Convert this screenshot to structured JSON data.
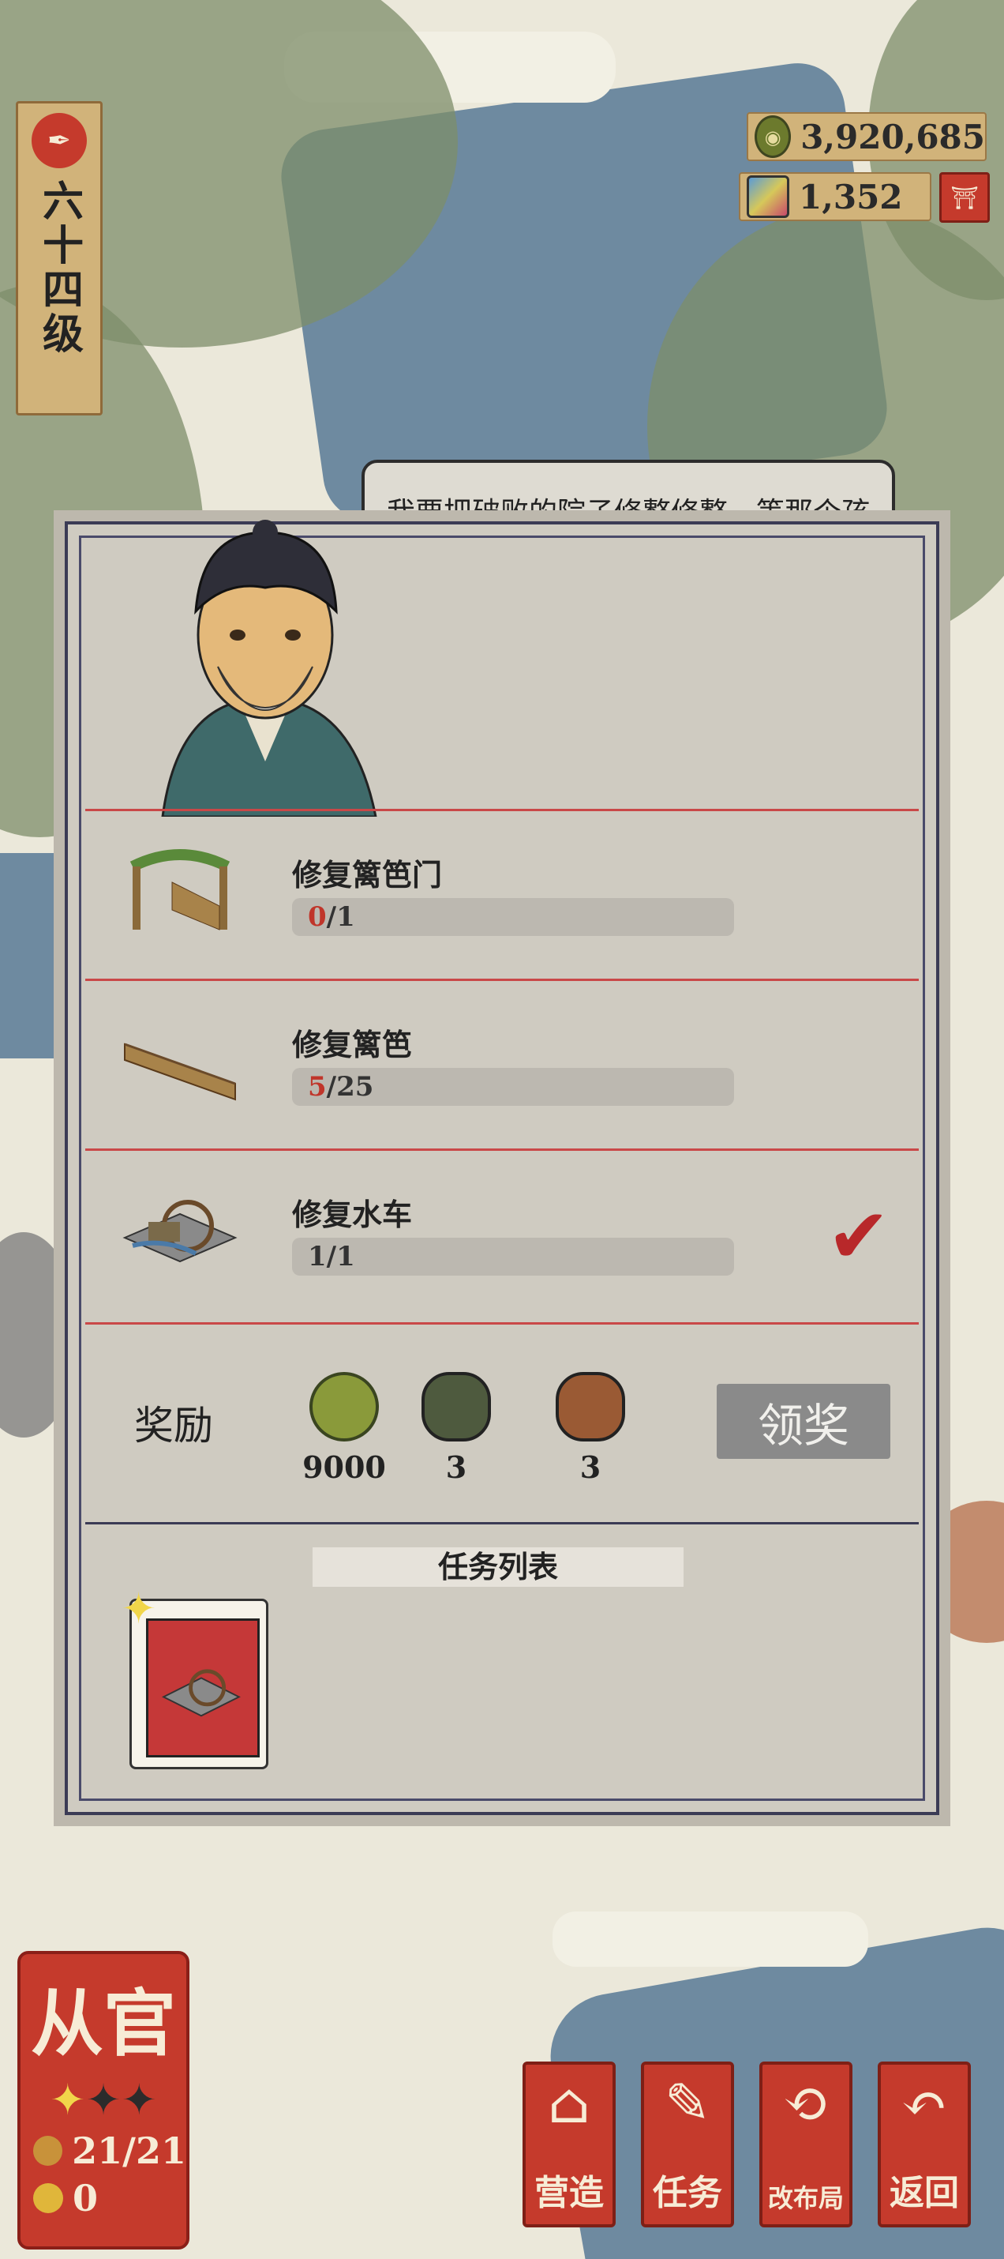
{
  "level": {
    "emblem_icon": "brush-icon",
    "text": "六十四级"
  },
  "currency": {
    "coins": {
      "icon": "coin-icon",
      "value": "3,920,685"
    },
    "gems": {
      "icon": "gem-icon",
      "value": "1,352"
    },
    "shop_icon": "shop-icon"
  },
  "dialogue": "我要把破败的院子修整修整，等那个孩子回来。",
  "tasks": [
    {
      "icon": "fence-gate-icon",
      "title": "修复篱笆门",
      "current": "0",
      "total": "/1",
      "done": false
    },
    {
      "icon": "fence-icon",
      "title": "修复篱笆",
      "current": "5",
      "total": "/25",
      "done": false
    },
    {
      "icon": "waterwheel-icon",
      "title": "修复水车",
      "current": "1",
      "total": "/1",
      "done": true
    }
  ],
  "reward": {
    "label": "奖励",
    "items": [
      {
        "icon": "coin-icon",
        "value": "9000"
      },
      {
        "icon": "stone-icon",
        "value": "3"
      },
      {
        "icon": "ore-icon",
        "value": "3"
      }
    ],
    "claim_label": "领奖"
  },
  "task_list": {
    "title": "任务列表"
  },
  "rank": {
    "name": "从官",
    "stars_lit": 1,
    "stars_total": 3,
    "workers": "21/21",
    "idle": "0"
  },
  "nav": [
    {
      "icon": "building-icon",
      "label": "营造"
    },
    {
      "icon": "scroll-icon",
      "label": "任务"
    },
    {
      "icon": "redesign-icon",
      "label": "改布局"
    },
    {
      "icon": "return-icon",
      "label": "返回"
    }
  ],
  "colors": {
    "accent_red": "#c53a2c",
    "progress_red": "#c0352a",
    "panel_bg": "#cfcbc1"
  }
}
